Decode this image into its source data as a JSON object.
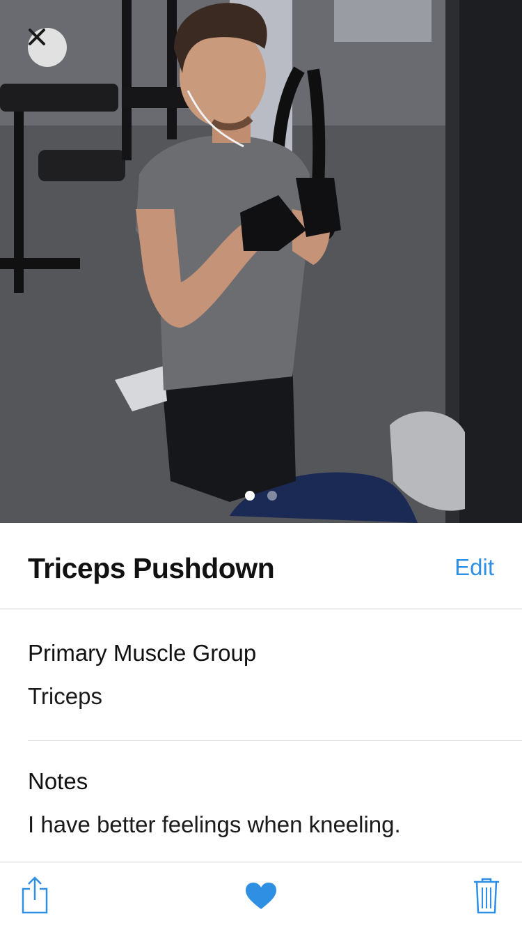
{
  "photo": {
    "page_count": 2,
    "current_page": 1
  },
  "exercise": {
    "title": "Triceps Pushdown",
    "edit_label": "Edit"
  },
  "details": {
    "muscle_label": "Primary Muscle Group",
    "muscle_value": "Triceps",
    "notes_label": "Notes",
    "notes_value": "I have better feelings when kneeling."
  },
  "toolbar": {
    "share_icon": "share-icon",
    "favorite_icon": "heart-icon",
    "delete_icon": "trash-icon",
    "accent_color": "#2f8fe3"
  }
}
